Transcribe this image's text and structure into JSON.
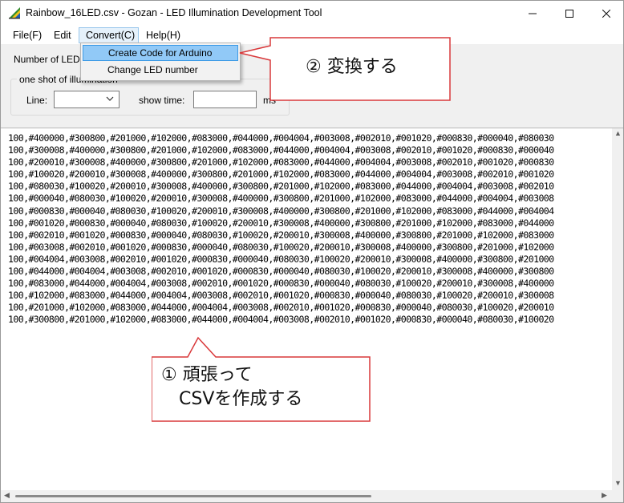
{
  "window": {
    "title": "Rainbow_16LED.csv - Gozan - LED Illumination Development Tool"
  },
  "menu": {
    "file": "File(F)",
    "edit": "Edit",
    "convert": "Convert(C)",
    "help": "Help(H)"
  },
  "convert_menu": {
    "items": [
      "Create Code for Arduino",
      "Change LED number"
    ]
  },
  "settings": {
    "number_of_led_label": "Number of LED",
    "group_title": "one shot of illumination",
    "line_label": "Line:",
    "line_value": "",
    "show_time_label": "show time:",
    "show_time_value": "",
    "ms_label": "ms"
  },
  "data_lines": [
    "100,#400000,#300800,#201000,#102000,#083000,#044000,#004004,#003008,#002010,#001020,#000830,#000040,#080030",
    "100,#300008,#400000,#300800,#201000,#102000,#083000,#044000,#004004,#003008,#002010,#001020,#000830,#000040",
    "100,#200010,#300008,#400000,#300800,#201000,#102000,#083000,#044000,#004004,#003008,#002010,#001020,#000830",
    "100,#100020,#200010,#300008,#400000,#300800,#201000,#102000,#083000,#044000,#004004,#003008,#002010,#001020",
    "100,#080030,#100020,#200010,#300008,#400000,#300800,#201000,#102000,#083000,#044000,#004004,#003008,#002010",
    "100,#000040,#080030,#100020,#200010,#300008,#400000,#300800,#201000,#102000,#083000,#044000,#004004,#003008",
    "100,#000830,#000040,#080030,#100020,#200010,#300008,#400000,#300800,#201000,#102000,#083000,#044000,#004004",
    "100,#001020,#000830,#000040,#080030,#100020,#200010,#300008,#400000,#300800,#201000,#102000,#083000,#044000",
    "100,#002010,#001020,#000830,#000040,#080030,#100020,#200010,#300008,#400000,#300800,#201000,#102000,#083000",
    "100,#003008,#002010,#001020,#000830,#000040,#080030,#100020,#200010,#300008,#400000,#300800,#201000,#102000",
    "100,#004004,#003008,#002010,#001020,#000830,#000040,#080030,#100020,#200010,#300008,#400000,#300800,#201000",
    "100,#044000,#004004,#003008,#002010,#001020,#000830,#000040,#080030,#100020,#200010,#300008,#400000,#300800",
    "100,#083000,#044000,#004004,#003008,#002010,#001020,#000830,#000040,#080030,#100020,#200010,#300008,#400000",
    "100,#102000,#083000,#044000,#004004,#003008,#002010,#001020,#000830,#000040,#080030,#100020,#200010,#300008",
    "100,#201000,#102000,#083000,#044000,#004004,#003008,#002010,#001020,#000830,#000040,#080030,#100020,#200010",
    "100,#300800,#201000,#102000,#083000,#044000,#004004,#003008,#002010,#001020,#000830,#000040,#080030,#100020"
  ],
  "annotations": {
    "step2": "② 変換する",
    "step1_line1": "① 頑張って",
    "step1_line2": "　CSVを作成する"
  },
  "colors": {
    "callout_border": "#d9383a",
    "menu_highlight": "#91c9f7",
    "menu_highlight_border": "#3c9ae6"
  },
  "icons": [
    "app-icon",
    "minimize-icon",
    "maximize-icon",
    "close-icon",
    "chevron-down-icon",
    "scroll-up-icon",
    "scroll-down-icon",
    "scroll-left-icon",
    "scroll-right-icon"
  ]
}
